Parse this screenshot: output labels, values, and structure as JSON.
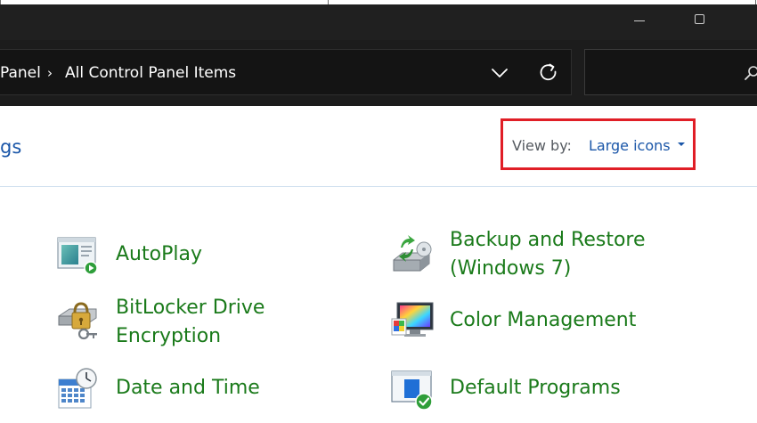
{
  "window": {
    "minimize_icon": "minimize-icon",
    "maximize_icon": "maximize-icon"
  },
  "address_bar": {
    "breadcrumbs": [
      {
        "label": "Panel"
      },
      {
        "label": "All Control Panel Items"
      }
    ],
    "dropdown_icon": "chevron-down-icon",
    "refresh_icon": "refresh-icon"
  },
  "search": {
    "placeholder": "",
    "icon": "search-icon"
  },
  "page": {
    "heading": "gs"
  },
  "view_by": {
    "label": "View by:",
    "selected": "Large icons"
  },
  "items": [
    {
      "label": "AutoPlay",
      "icon": "autoplay-icon"
    },
    {
      "label": "Backup and Restore\n(Windows 7)",
      "icon": "backup-restore-icon"
    },
    {
      "label": "BitLocker Drive\nEncryption",
      "icon": "bitlocker-icon"
    },
    {
      "label": "Color Management",
      "icon": "color-management-icon"
    },
    {
      "label": "Date and Time",
      "icon": "date-time-icon"
    },
    {
      "label": "Default Programs",
      "icon": "default-programs-icon"
    }
  ],
  "colors": {
    "link_green": "#1a7a1a",
    "link_blue": "#1a56a8",
    "highlight_red": "#e01e26",
    "titlebar": "#202020"
  }
}
